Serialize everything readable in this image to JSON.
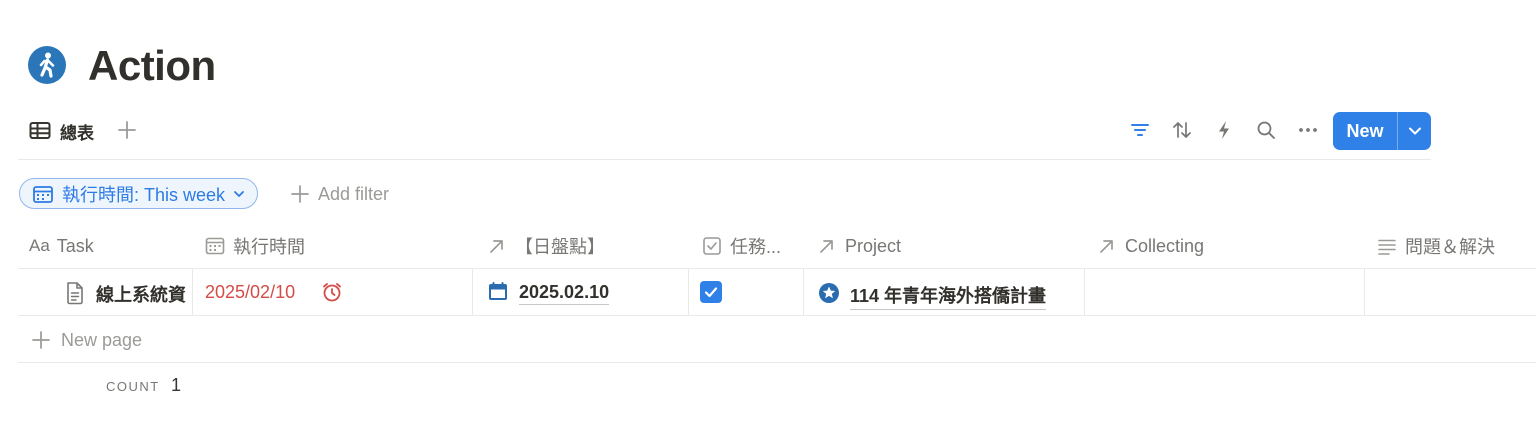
{
  "page": {
    "title": "Action",
    "icon": "walking-person-icon"
  },
  "view": {
    "tab_label": "總表",
    "toolbar": {
      "icons": [
        "filter-icon",
        "sort-icon",
        "automation-icon",
        "search-icon",
        "more-icon"
      ],
      "new_button_label": "New"
    }
  },
  "filters": {
    "active": {
      "label": "執行時間: This week"
    },
    "add_label": "Add filter"
  },
  "table": {
    "columns": [
      {
        "prefix": "Aa",
        "label": "Task"
      },
      {
        "label": "執行時間"
      },
      {
        "label": "【日盤點】"
      },
      {
        "label": "任務..."
      },
      {
        "label": "Project"
      },
      {
        "label": "Collecting"
      },
      {
        "label": "問題＆解決"
      }
    ],
    "rows": [
      {
        "task": "線上系統資",
        "due": "2025/02/10",
        "daily_check": "2025.02.10",
        "done": true,
        "project": "114 年青年海外搭僑計畫",
        "collecting": "",
        "notes": ""
      }
    ],
    "new_page_label": "New page",
    "count_label": "COUNT",
    "count_value": "1"
  },
  "colors": {
    "accent": "#2f80e7",
    "overdue": "#d44c47",
    "text": "#37352f",
    "muted": "#787774",
    "page_icon_bg": "#2b76b9"
  }
}
